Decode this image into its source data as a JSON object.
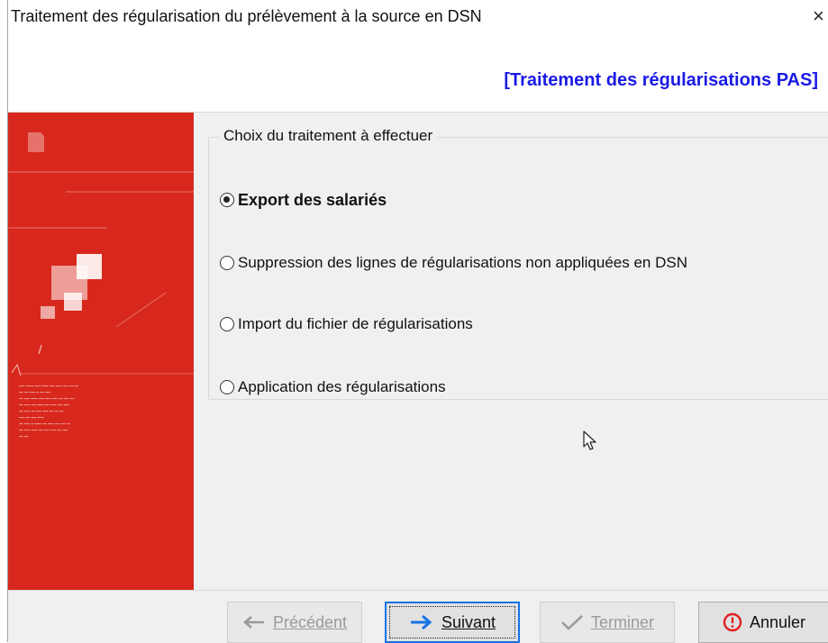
{
  "window": {
    "title": "Traitement des régularisation du prélèvement à la source en DSN",
    "close_glyph": "×"
  },
  "header": {
    "title": "[Traitement des régularisations PAS]"
  },
  "groupbox": {
    "legend": "Choix du traitement à effectuer",
    "options": [
      {
        "label": "Export des salariés",
        "selected": true
      },
      {
        "label": "Suppression des lignes de régularisations non appliquées en DSN",
        "selected": false
      },
      {
        "label": "Import du fichier de régularisations",
        "selected": false
      },
      {
        "label": "Application des régularisations",
        "selected": false
      }
    ]
  },
  "buttons": {
    "previous": {
      "label": "Précédent",
      "icon": "arrow-left-icon",
      "enabled": false
    },
    "next": {
      "label": "Suivant",
      "icon": "arrow-right-icon",
      "enabled": true
    },
    "finish": {
      "label": "Terminer",
      "icon": "checkmark-icon",
      "enabled": false
    },
    "cancel": {
      "label": "Annuler",
      "icon": "cancel-circle-icon",
      "enabled": true
    }
  },
  "colors": {
    "side_panel": "#d8281d",
    "header_title": "#1a1ae6",
    "accent_blue": "#1473e6",
    "cancel_red": "#e02020"
  }
}
